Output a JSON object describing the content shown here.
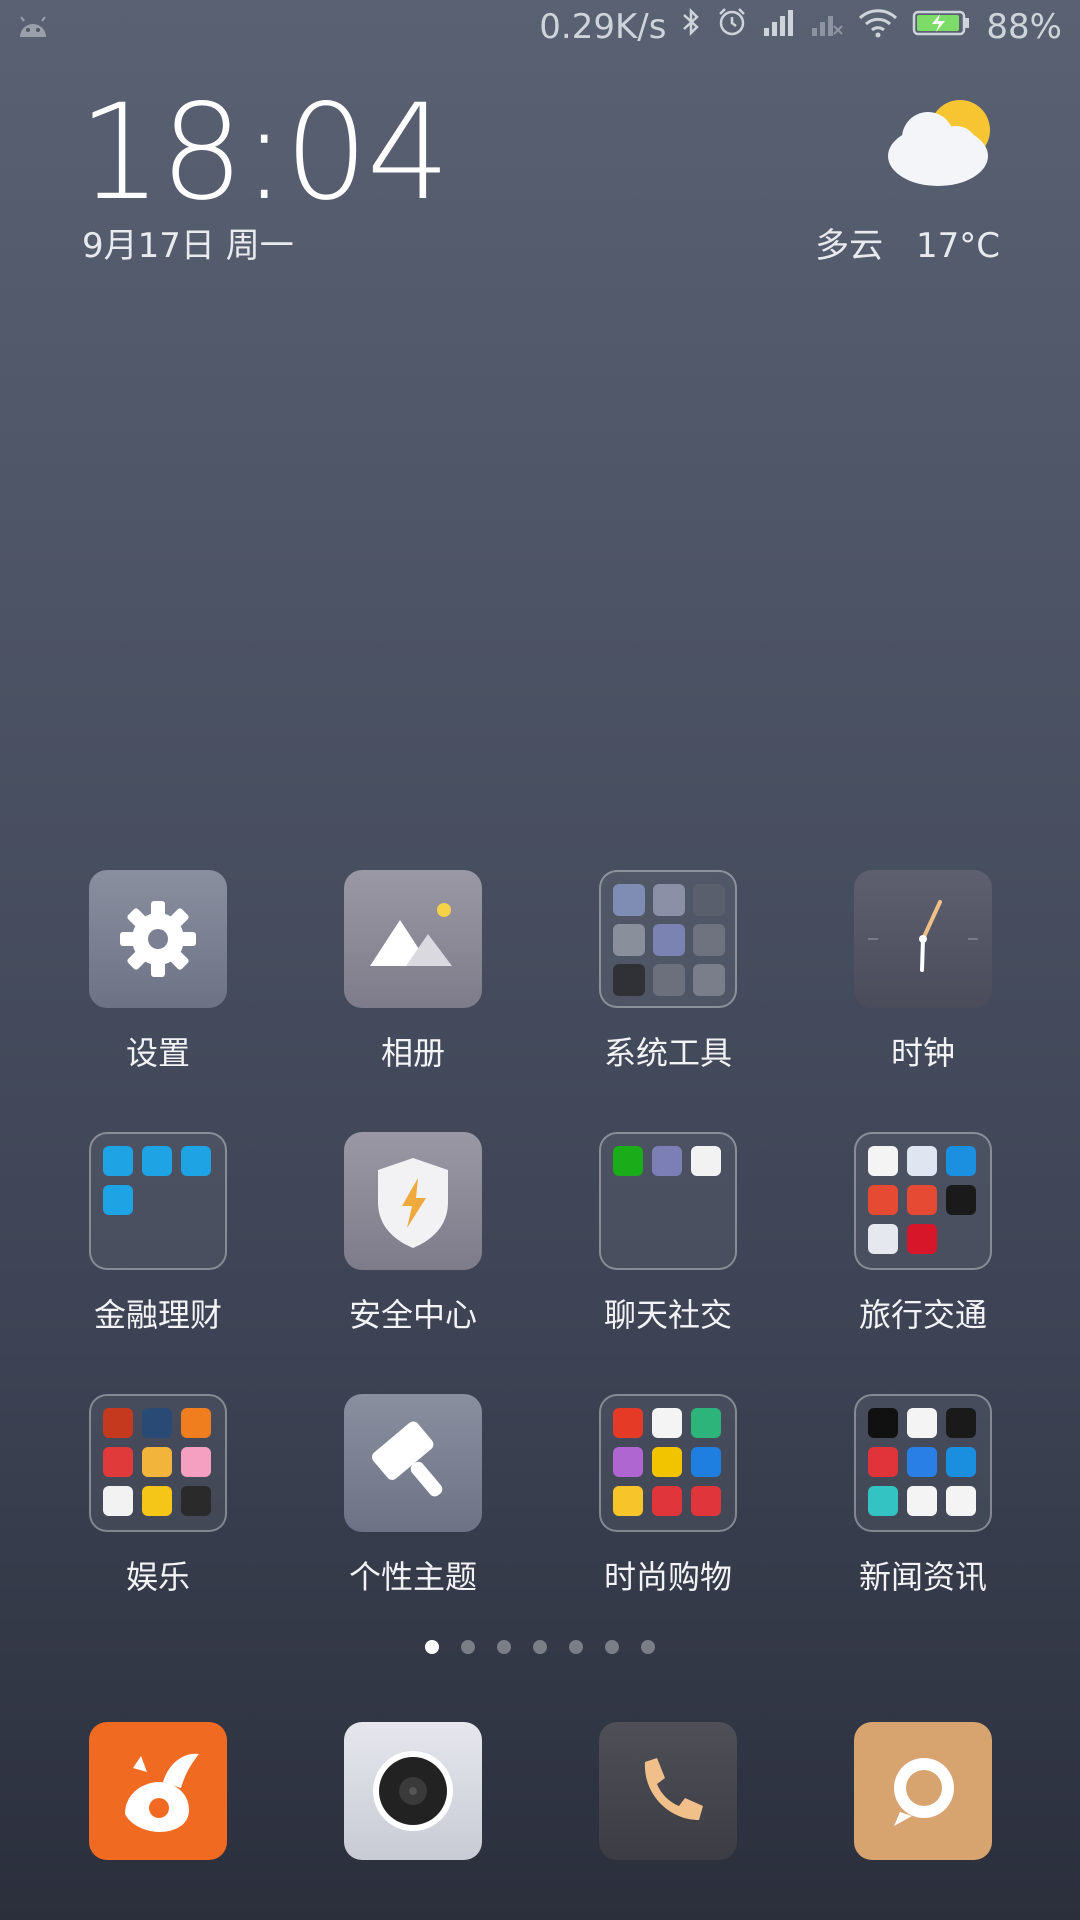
{
  "status_bar": {
    "network_speed": "0.29K/s",
    "battery": "88%",
    "icons": [
      "android-icon",
      "bluetooth-icon",
      "alarm-icon",
      "signal-icon",
      "signal-off-icon",
      "wifi-icon",
      "battery-charging-icon"
    ]
  },
  "clock": {
    "time": "18:04",
    "date": "9月17日 周一"
  },
  "weather": {
    "condition": "多云",
    "temperature": "17°C",
    "icon": "partly-cloudy-icon"
  },
  "apps": [
    {
      "label": "设置",
      "icon": "settings-icon"
    },
    {
      "label": "相册",
      "icon": "gallery-icon"
    },
    {
      "label": "系统工具",
      "icon": "folder-icon",
      "folder": true
    },
    {
      "label": "时钟",
      "icon": "clock-icon"
    },
    {
      "label": "金融理财",
      "icon": "folder-icon",
      "folder": true
    },
    {
      "label": "安全中心",
      "icon": "shield-icon"
    },
    {
      "label": "聊天社交",
      "icon": "folder-icon",
      "folder": true
    },
    {
      "label": "旅行交通",
      "icon": "folder-icon",
      "folder": true
    },
    {
      "label": "娱乐",
      "icon": "folder-icon",
      "folder": true
    },
    {
      "label": "个性主题",
      "icon": "brush-icon"
    },
    {
      "label": "时尚购物",
      "icon": "folder-icon",
      "folder": true
    },
    {
      "label": "新闻资讯",
      "icon": "folder-icon",
      "folder": true
    }
  ],
  "folder_minis": {
    "system_tools": [
      "#7f8db5",
      "#8b90a6",
      "#5a5f6d",
      "#8a8f9c",
      "#7b83b3",
      "#6f7380",
      "#2f3137",
      "#6c707c",
      "#7a7e8a"
    ],
    "finance": [
      "#1ea3e4",
      "#1ea3e4",
      "#1ea3e4",
      "#1ea3e4"
    ],
    "chat": [
      "#1aad19",
      "#7b7fb5",
      "#f2f2f2"
    ],
    "travel": [
      "#f4f4f4",
      "#dfe6f2",
      "#1b8fe0",
      "#e74a33",
      "#e74a33",
      "#1a1a1a",
      "#e6e8f0",
      "#d8162a"
    ],
    "entertainment": [
      "#c53a1f",
      "#2a4a76",
      "#f07d1e",
      "#e03a3a",
      "#f2b43a",
      "#f5a0c0",
      "#f2f2f2",
      "#f5c518",
      "#2a2a2a"
    ],
    "shopping": [
      "#e53a26",
      "#f4f4f4",
      "#2db47a",
      "#b066d0",
      "#f2c400",
      "#1e7fe0",
      "#f7c52a",
      "#e0363b",
      "#e0363b"
    ],
    "news": [
      "#111111",
      "#f4f4f4",
      "#1a1a1a",
      "#e0343a",
      "#2a7fe6",
      "#1a8fe0",
      "#33c3c3",
      "#f4f4f4",
      "#f4f4f4"
    ]
  },
  "page_indicator": {
    "total": 7,
    "active": 1
  },
  "dock": [
    {
      "name": "uc-browser",
      "icon": "uc-browser-icon",
      "color": "#f16a22"
    },
    {
      "name": "camera",
      "icon": "camera-icon",
      "color": "#d9dbe2"
    },
    {
      "name": "phone",
      "icon": "phone-icon",
      "color": "#45464d"
    },
    {
      "name": "messages",
      "icon": "chat-bubble-icon",
      "color": "#d7a36f"
    }
  ]
}
